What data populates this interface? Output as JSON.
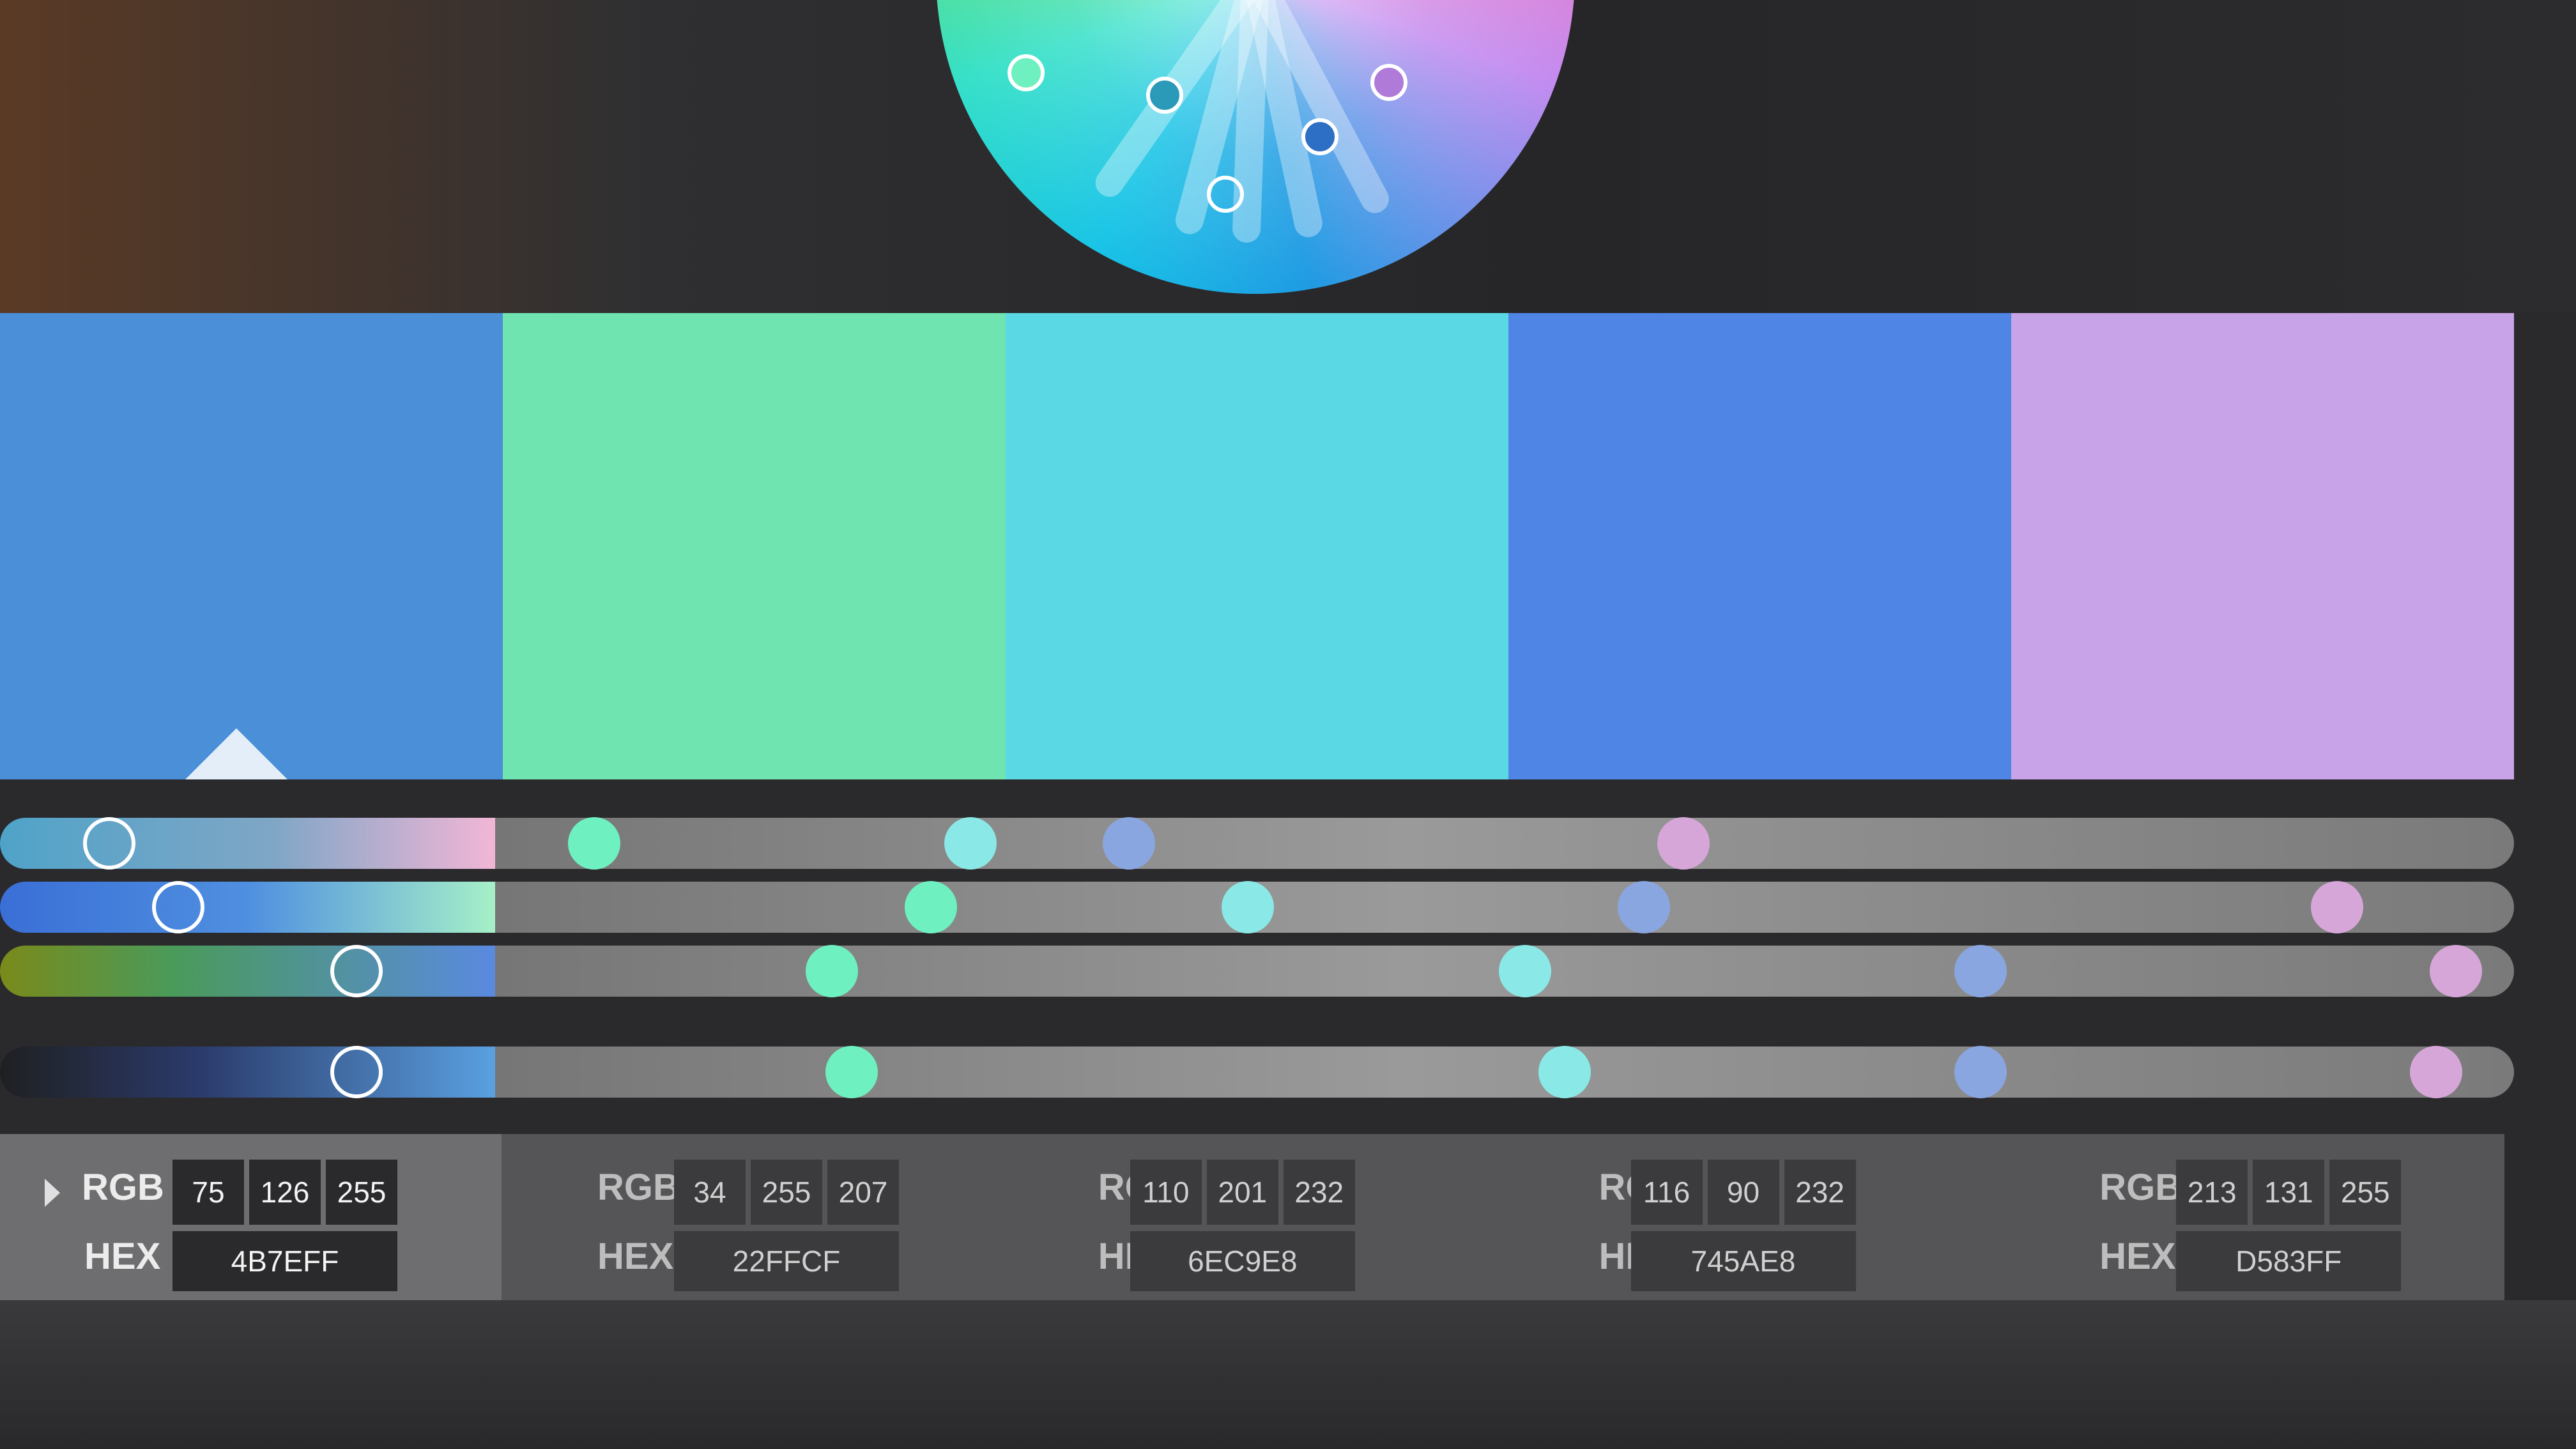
{
  "colors": [
    {
      "rgb": [
        "75",
        "126",
        "255"
      ],
      "hex": "4B7EFF",
      "swatch": "#4a8fd8",
      "dot": "#5aaedb",
      "active": true
    },
    {
      "rgb": [
        "34",
        "255",
        "207"
      ],
      "hex": "22FFCF",
      "swatch": "#6fe3b0",
      "dot": "#6ff0c0",
      "active": false
    },
    {
      "rgb": [
        "110",
        "201",
        "232"
      ],
      "hex": "6EC9E8",
      "swatch": "#5ad8e3",
      "dot": "#8ae8e6",
      "active": false
    },
    {
      "rgb": [
        "116",
        "90",
        "232"
      ],
      "hex": "745AE8",
      "swatch": "#4f86e6",
      "dot": "#8aa6e0",
      "active": false
    },
    {
      "rgb": [
        "213",
        "131",
        "255"
      ],
      "hex": "D583FF",
      "swatch": "#c9a3e8",
      "dot": "#d6a6d8",
      "active": false
    }
  ],
  "labels": {
    "rgb": "RGB",
    "hex": "HEX"
  },
  "slider_levels": [
    [
      0.22,
      0.05,
      0.24,
      0.32,
      0.6
    ],
    [
      0.36,
      0.22,
      0.38,
      0.58,
      0.93
    ],
    [
      0.72,
      0.17,
      0.52,
      0.75,
      0.99
    ],
    [
      0.72,
      0.18,
      0.54,
      0.75,
      0.98
    ]
  ]
}
